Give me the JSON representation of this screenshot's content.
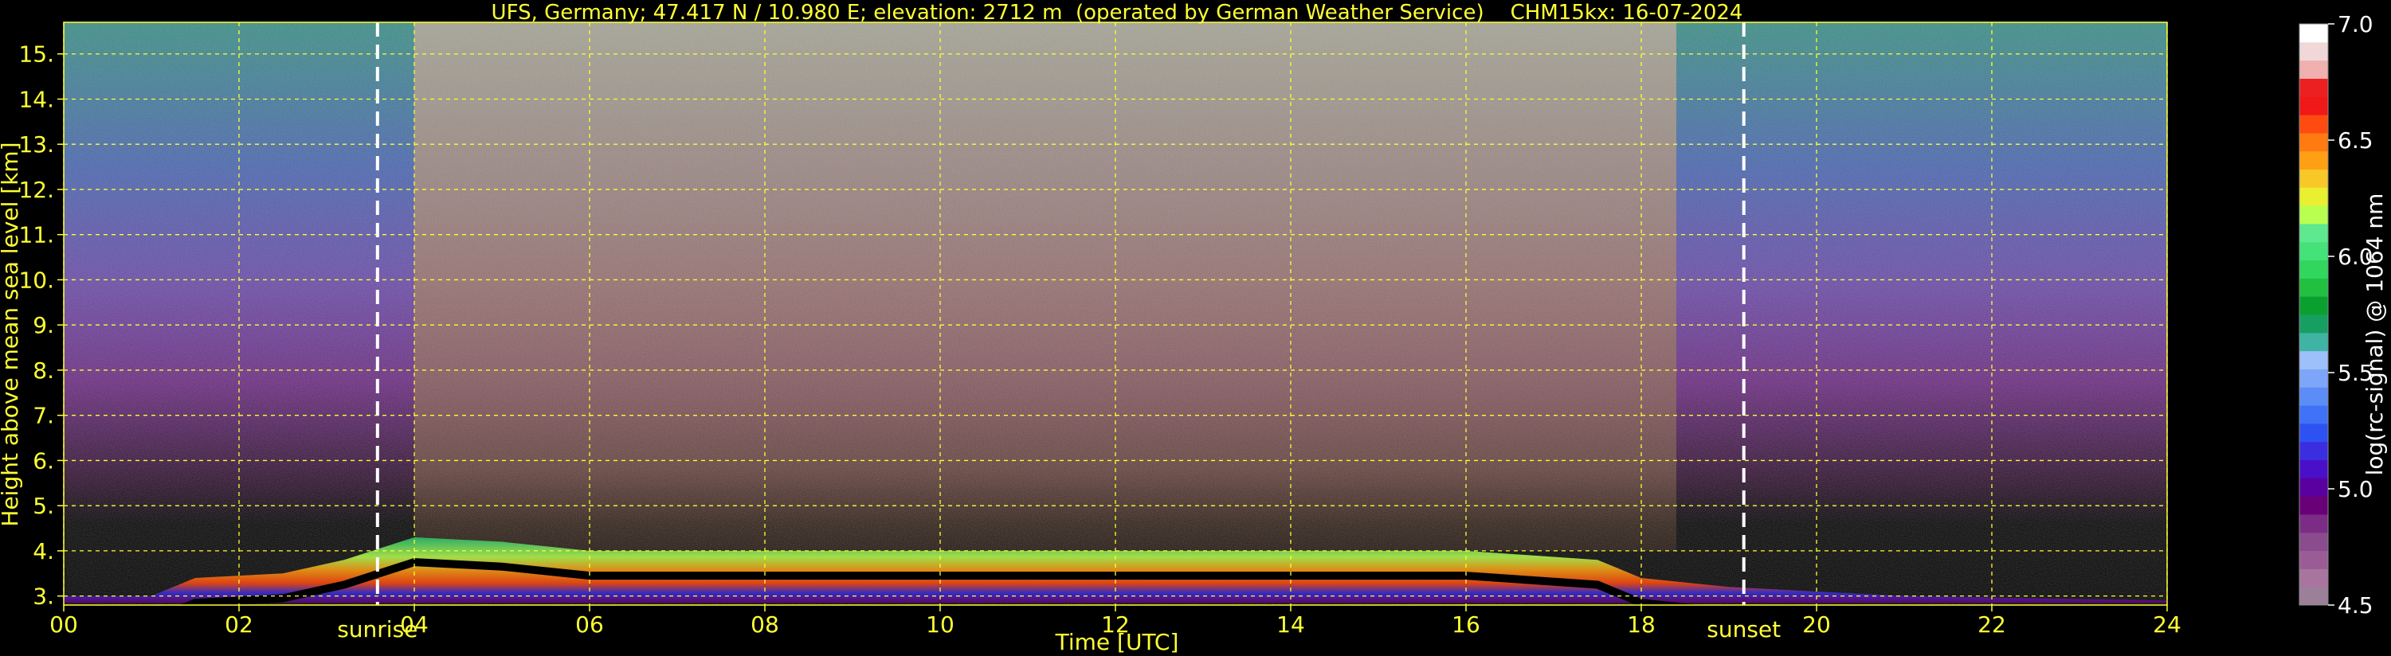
{
  "chart_data": {
    "type": "heatmap",
    "title": "UFS, Germany; 47.417 N / 10.980 E; elevation: 2712 m  (operated by German Weather Service)    CHM15kx: 16-07-2024",
    "xlabel": "Time [UTC]",
    "ylabel": "Height above mean sea level [km]",
    "xlim": [
      0,
      24
    ],
    "ylim": [
      2.8,
      15.7
    ],
    "grid": true,
    "x_ticks": [
      "00",
      "02",
      "04",
      "06",
      "08",
      "10",
      "12",
      "14",
      "16",
      "18",
      "20",
      "22",
      "24"
    ],
    "y_ticks": [
      "3.",
      "4.",
      "5.",
      "6.",
      "7.",
      "8.",
      "9.",
      "10.",
      "11.",
      "12.",
      "13.",
      "14.",
      "15."
    ],
    "markers": [
      {
        "label": "sunrise",
        "x": 3.58
      },
      {
        "label": "sunset",
        "x": 19.17
      }
    ],
    "colorbar": {
      "label": "log(rc-signal) @ 1064 nm",
      "range": [
        4.5,
        7.0
      ],
      "ticks": [
        "4.5",
        "5.0",
        "5.5",
        "6.0",
        "6.5",
        "7.0"
      ],
      "colors": [
        "#9c7f98",
        "#a8759f",
        "#9b5c96",
        "#8a4c8c",
        "#7b2d86",
        "#6a0077",
        "#5a00a0",
        "#4a10c8",
        "#3a2ee0",
        "#2e52f2",
        "#3f72f6",
        "#5c8cf6",
        "#7ea6f8",
        "#9ec0fa",
        "#3fb4a4",
        "#169f60",
        "#0aa030",
        "#21c040",
        "#31d65e",
        "#45e27a",
        "#5ee890",
        "#b8ff50",
        "#e8f030",
        "#f8c828",
        "#ffa014",
        "#ff7a10",
        "#ff4a10",
        "#f01818",
        "#ec2020",
        "#f0b0b0",
        "#f0d8d8",
        "#ffffff"
      ]
    },
    "boundary_layer_signal": [
      {
        "t": 0.0,
        "top": 3.0
      },
      {
        "t": 1.0,
        "top": 3.0
      },
      {
        "t": 1.5,
        "top": 3.4
      },
      {
        "t": 2.5,
        "top": 3.5
      },
      {
        "t": 3.2,
        "top": 3.8
      },
      {
        "t": 4.0,
        "top": 4.3
      },
      {
        "t": 5.0,
        "top": 4.2
      },
      {
        "t": 6.0,
        "top": 4.0
      },
      {
        "t": 8.0,
        "top": 4.0
      },
      {
        "t": 10.0,
        "top": 4.0
      },
      {
        "t": 12.0,
        "top": 4.0
      },
      {
        "t": 14.0,
        "top": 4.0
      },
      {
        "t": 16.0,
        "top": 4.0
      },
      {
        "t": 17.5,
        "top": 3.8
      },
      {
        "t": 18.0,
        "top": 3.4
      },
      {
        "t": 19.0,
        "top": 3.2
      },
      {
        "t": 21.0,
        "top": 3.0
      },
      {
        "t": 24.0,
        "top": 2.9
      }
    ]
  }
}
